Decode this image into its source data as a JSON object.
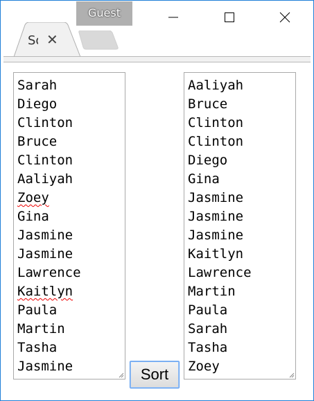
{
  "browser": {
    "profile_label": "Guest",
    "tab_title": "Sort",
    "window_controls": [
      "minimize-icon",
      "maximize-icon",
      "close-icon"
    ]
  },
  "input_names": [
    "Sarah",
    "Diego",
    "Clinton",
    "Bruce",
    "Clinton",
    "Aaliyah",
    "Zoey",
    "Gina",
    "Jasmine",
    "Jasmine",
    "Lawrence",
    "Kaitlyn",
    "Paula",
    "Martin",
    "Tasha",
    "Jasmine"
  ],
  "spellcheck_flagged": [
    "Zoey",
    "Kaitlyn"
  ],
  "sort_button_label": "Sort",
  "sorted_names": [
    "Aaliyah",
    "Bruce",
    "Clinton",
    "Clinton",
    "Diego",
    "Gina",
    "Jasmine",
    "Jasmine",
    "Jasmine",
    "Kaitlyn",
    "Lawrence",
    "Martin",
    "Paula",
    "Sarah",
    "Tasha",
    "Zoey"
  ]
}
